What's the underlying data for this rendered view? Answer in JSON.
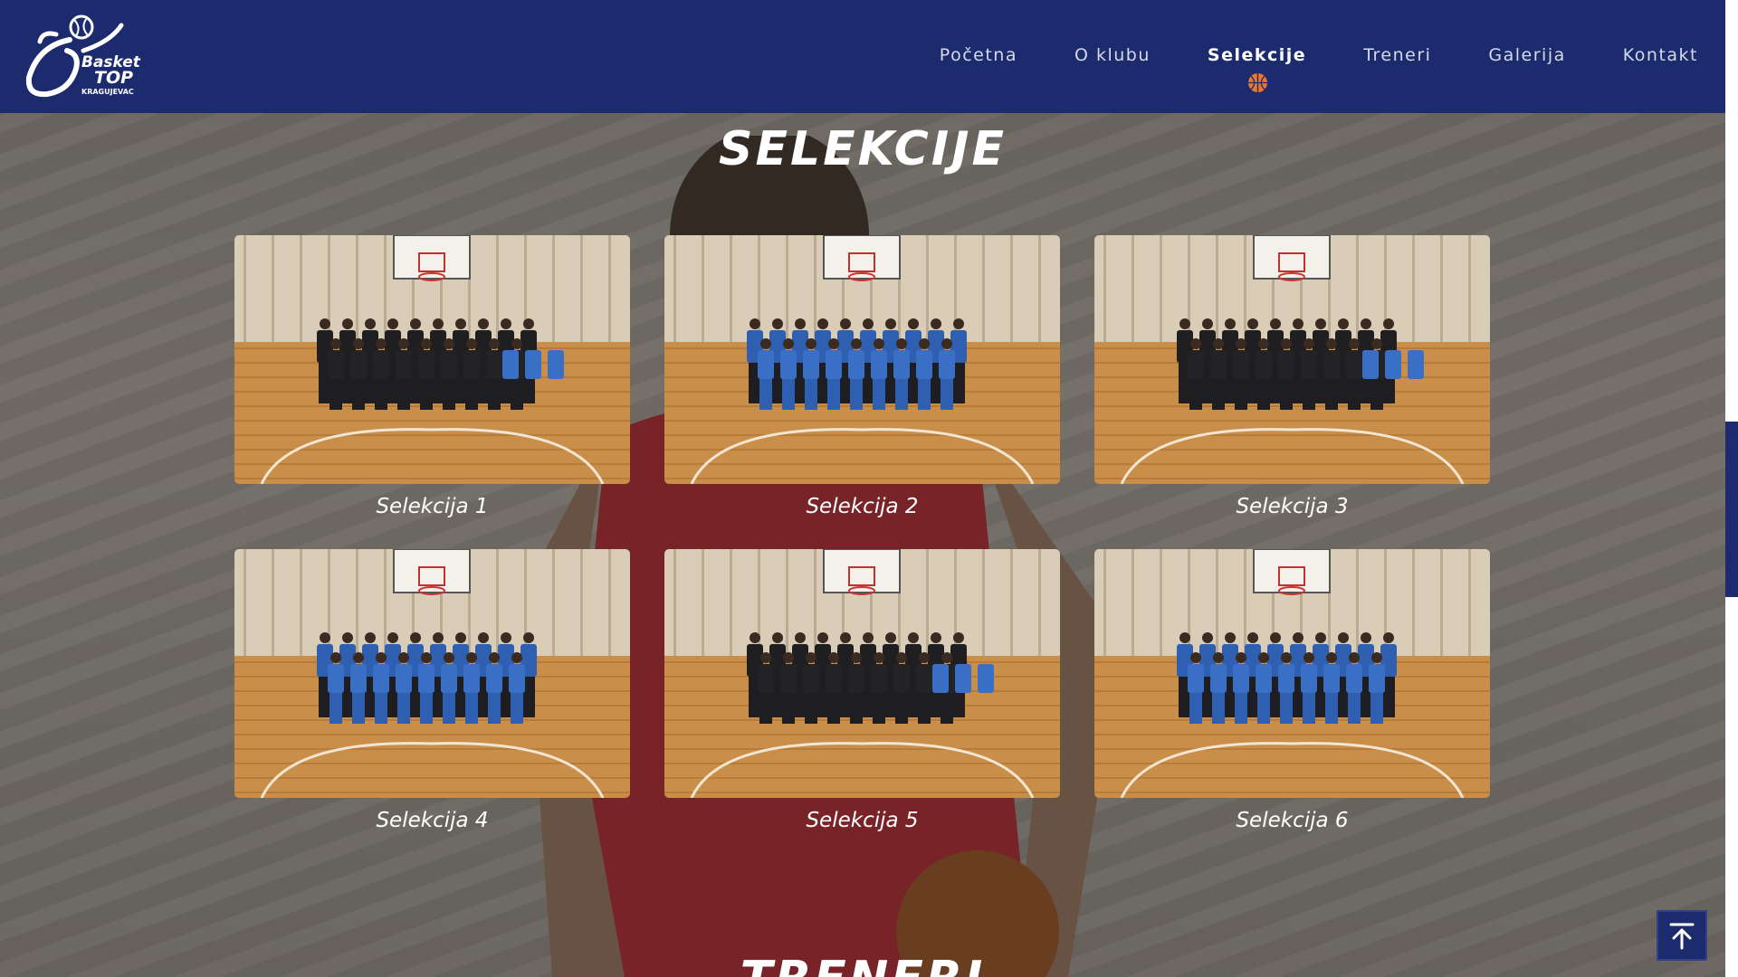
{
  "header": {
    "logo_text": "Basket TOP KRAGUJEVAC",
    "nav": [
      {
        "label": "Početna",
        "active": false
      },
      {
        "label": "O klubu",
        "active": false
      },
      {
        "label": "Selekcije",
        "active": true
      },
      {
        "label": "Treneri",
        "active": false
      },
      {
        "label": "Galerija",
        "active": false
      },
      {
        "label": "Kontakt",
        "active": false
      }
    ]
  },
  "section": {
    "title": "SELEKCIJE",
    "cards": [
      {
        "caption": "Selekcija 1",
        "jerseys": "dark"
      },
      {
        "caption": "Selekcija 2",
        "jerseys": "blue"
      },
      {
        "caption": "Selekcija 3",
        "jerseys": "dark"
      },
      {
        "caption": "Selekcija 4",
        "jerseys": "blue"
      },
      {
        "caption": "Selekcija 5",
        "jerseys": "dark"
      },
      {
        "caption": "Selekcija 6",
        "jerseys": "blue"
      }
    ]
  },
  "next_section_title": "TRENERI",
  "icons": {
    "basketball": "basketball-icon",
    "to_top": "arrow-up-to-line-icon"
  },
  "colors": {
    "header_bg": "#1c2a6e",
    "accent": "#e8772e",
    "text": "#ffffff"
  }
}
